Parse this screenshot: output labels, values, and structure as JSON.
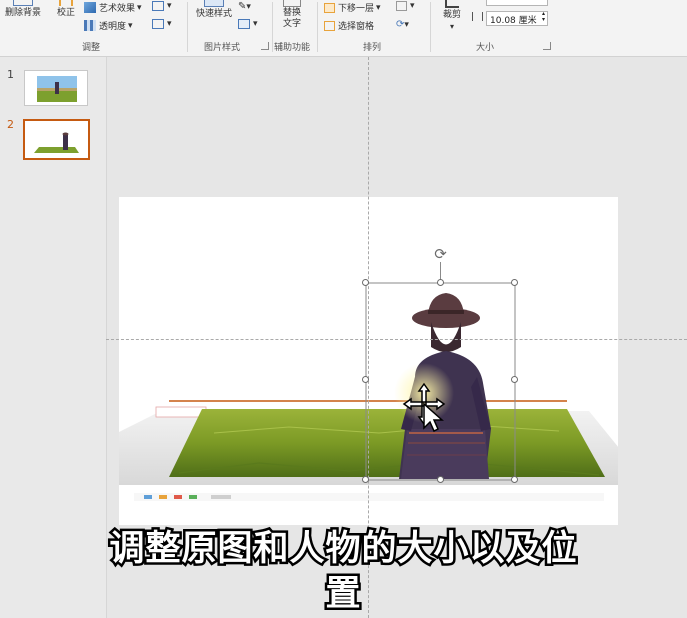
{
  "ribbon": {
    "remove_bg_label": "删除背景",
    "correct_label": "校正",
    "art_effects_label": "艺术效果",
    "transparency_label": "透明度",
    "adjust_group_label": "调整",
    "quick_styles_label": "快速样式",
    "picture_styles_group_label": "图片样式",
    "alt_text_label": "替换文字",
    "accessibility_group_label": "辅助功能",
    "send_backward_label": "下移一层",
    "selection_pane_label": "选择窗格",
    "arrange_group_label": "排列",
    "crop_label": "裁剪",
    "width_value": "10.08 厘米",
    "size_group_label": "大小"
  },
  "thumbnails": [
    {
      "number": "1",
      "selected": false
    },
    {
      "number": "2",
      "selected": true
    }
  ],
  "caption": {
    "line1": "调整原图和人物的大小以及位",
    "line2": "置"
  },
  "colors": {
    "accent_orange": "#c55a11",
    "field_green": "#7da02e",
    "sky_blue": "#5f9fd8"
  }
}
